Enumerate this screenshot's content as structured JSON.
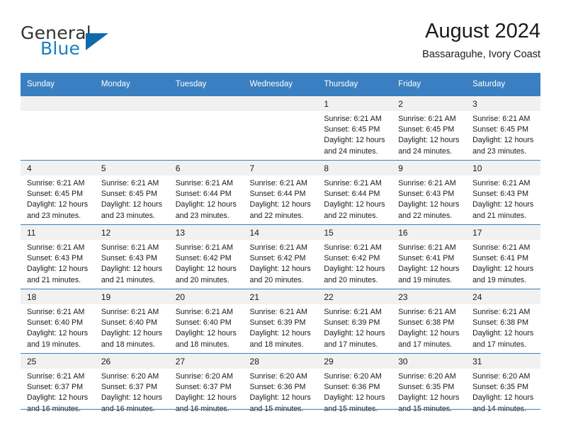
{
  "brand": {
    "name_top": "General",
    "name_bottom": "Blue",
    "triangle_icon": "blue-triangle-logo",
    "accent_color": "#1b7ec2"
  },
  "header": {
    "title": "August 2024",
    "subtitle": "Bassaraguhe, Ivory Coast"
  },
  "theme": {
    "header_blue": "#3a7fc1",
    "daynum_band": "#f1f1f1",
    "text": "#1a1a1a"
  },
  "weekday_headers": [
    "Sunday",
    "Monday",
    "Tuesday",
    "Wednesday",
    "Thursday",
    "Friday",
    "Saturday"
  ],
  "weeks": [
    [
      {
        "day": "",
        "sunrise": "",
        "sunset": "",
        "daylight_line1": "",
        "daylight_line2": ""
      },
      {
        "day": "",
        "sunrise": "",
        "sunset": "",
        "daylight_line1": "",
        "daylight_line2": ""
      },
      {
        "day": "",
        "sunrise": "",
        "sunset": "",
        "daylight_line1": "",
        "daylight_line2": ""
      },
      {
        "day": "",
        "sunrise": "",
        "sunset": "",
        "daylight_line1": "",
        "daylight_line2": ""
      },
      {
        "day": "1",
        "sunrise": "Sunrise: 6:21 AM",
        "sunset": "Sunset: 6:45 PM",
        "daylight_line1": "Daylight: 12 hours",
        "daylight_line2": "and 24 minutes."
      },
      {
        "day": "2",
        "sunrise": "Sunrise: 6:21 AM",
        "sunset": "Sunset: 6:45 PM",
        "daylight_line1": "Daylight: 12 hours",
        "daylight_line2": "and 24 minutes."
      },
      {
        "day": "3",
        "sunrise": "Sunrise: 6:21 AM",
        "sunset": "Sunset: 6:45 PM",
        "daylight_line1": "Daylight: 12 hours",
        "daylight_line2": "and 23 minutes."
      }
    ],
    [
      {
        "day": "4",
        "sunrise": "Sunrise: 6:21 AM",
        "sunset": "Sunset: 6:45 PM",
        "daylight_line1": "Daylight: 12 hours",
        "daylight_line2": "and 23 minutes."
      },
      {
        "day": "5",
        "sunrise": "Sunrise: 6:21 AM",
        "sunset": "Sunset: 6:45 PM",
        "daylight_line1": "Daylight: 12 hours",
        "daylight_line2": "and 23 minutes."
      },
      {
        "day": "6",
        "sunrise": "Sunrise: 6:21 AM",
        "sunset": "Sunset: 6:44 PM",
        "daylight_line1": "Daylight: 12 hours",
        "daylight_line2": "and 23 minutes."
      },
      {
        "day": "7",
        "sunrise": "Sunrise: 6:21 AM",
        "sunset": "Sunset: 6:44 PM",
        "daylight_line1": "Daylight: 12 hours",
        "daylight_line2": "and 22 minutes."
      },
      {
        "day": "8",
        "sunrise": "Sunrise: 6:21 AM",
        "sunset": "Sunset: 6:44 PM",
        "daylight_line1": "Daylight: 12 hours",
        "daylight_line2": "and 22 minutes."
      },
      {
        "day": "9",
        "sunrise": "Sunrise: 6:21 AM",
        "sunset": "Sunset: 6:43 PM",
        "daylight_line1": "Daylight: 12 hours",
        "daylight_line2": "and 22 minutes."
      },
      {
        "day": "10",
        "sunrise": "Sunrise: 6:21 AM",
        "sunset": "Sunset: 6:43 PM",
        "daylight_line1": "Daylight: 12 hours",
        "daylight_line2": "and 21 minutes."
      }
    ],
    [
      {
        "day": "11",
        "sunrise": "Sunrise: 6:21 AM",
        "sunset": "Sunset: 6:43 PM",
        "daylight_line1": "Daylight: 12 hours",
        "daylight_line2": "and 21 minutes."
      },
      {
        "day": "12",
        "sunrise": "Sunrise: 6:21 AM",
        "sunset": "Sunset: 6:43 PM",
        "daylight_line1": "Daylight: 12 hours",
        "daylight_line2": "and 21 minutes."
      },
      {
        "day": "13",
        "sunrise": "Sunrise: 6:21 AM",
        "sunset": "Sunset: 6:42 PM",
        "daylight_line1": "Daylight: 12 hours",
        "daylight_line2": "and 20 minutes."
      },
      {
        "day": "14",
        "sunrise": "Sunrise: 6:21 AM",
        "sunset": "Sunset: 6:42 PM",
        "daylight_line1": "Daylight: 12 hours",
        "daylight_line2": "and 20 minutes."
      },
      {
        "day": "15",
        "sunrise": "Sunrise: 6:21 AM",
        "sunset": "Sunset: 6:42 PM",
        "daylight_line1": "Daylight: 12 hours",
        "daylight_line2": "and 20 minutes."
      },
      {
        "day": "16",
        "sunrise": "Sunrise: 6:21 AM",
        "sunset": "Sunset: 6:41 PM",
        "daylight_line1": "Daylight: 12 hours",
        "daylight_line2": "and 19 minutes."
      },
      {
        "day": "17",
        "sunrise": "Sunrise: 6:21 AM",
        "sunset": "Sunset: 6:41 PM",
        "daylight_line1": "Daylight: 12 hours",
        "daylight_line2": "and 19 minutes."
      }
    ],
    [
      {
        "day": "18",
        "sunrise": "Sunrise: 6:21 AM",
        "sunset": "Sunset: 6:40 PM",
        "daylight_line1": "Daylight: 12 hours",
        "daylight_line2": "and 19 minutes."
      },
      {
        "day": "19",
        "sunrise": "Sunrise: 6:21 AM",
        "sunset": "Sunset: 6:40 PM",
        "daylight_line1": "Daylight: 12 hours",
        "daylight_line2": "and 18 minutes."
      },
      {
        "day": "20",
        "sunrise": "Sunrise: 6:21 AM",
        "sunset": "Sunset: 6:40 PM",
        "daylight_line1": "Daylight: 12 hours",
        "daylight_line2": "and 18 minutes."
      },
      {
        "day": "21",
        "sunrise": "Sunrise: 6:21 AM",
        "sunset": "Sunset: 6:39 PM",
        "daylight_line1": "Daylight: 12 hours",
        "daylight_line2": "and 18 minutes."
      },
      {
        "day": "22",
        "sunrise": "Sunrise: 6:21 AM",
        "sunset": "Sunset: 6:39 PM",
        "daylight_line1": "Daylight: 12 hours",
        "daylight_line2": "and 17 minutes."
      },
      {
        "day": "23",
        "sunrise": "Sunrise: 6:21 AM",
        "sunset": "Sunset: 6:38 PM",
        "daylight_line1": "Daylight: 12 hours",
        "daylight_line2": "and 17 minutes."
      },
      {
        "day": "24",
        "sunrise": "Sunrise: 6:21 AM",
        "sunset": "Sunset: 6:38 PM",
        "daylight_line1": "Daylight: 12 hours",
        "daylight_line2": "and 17 minutes."
      }
    ],
    [
      {
        "day": "25",
        "sunrise": "Sunrise: 6:21 AM",
        "sunset": "Sunset: 6:37 PM",
        "daylight_line1": "Daylight: 12 hours",
        "daylight_line2": "and 16 minutes."
      },
      {
        "day": "26",
        "sunrise": "Sunrise: 6:20 AM",
        "sunset": "Sunset: 6:37 PM",
        "daylight_line1": "Daylight: 12 hours",
        "daylight_line2": "and 16 minutes."
      },
      {
        "day": "27",
        "sunrise": "Sunrise: 6:20 AM",
        "sunset": "Sunset: 6:37 PM",
        "daylight_line1": "Daylight: 12 hours",
        "daylight_line2": "and 16 minutes."
      },
      {
        "day": "28",
        "sunrise": "Sunrise: 6:20 AM",
        "sunset": "Sunset: 6:36 PM",
        "daylight_line1": "Daylight: 12 hours",
        "daylight_line2": "and 15 minutes."
      },
      {
        "day": "29",
        "sunrise": "Sunrise: 6:20 AM",
        "sunset": "Sunset: 6:36 PM",
        "daylight_line1": "Daylight: 12 hours",
        "daylight_line2": "and 15 minutes."
      },
      {
        "day": "30",
        "sunrise": "Sunrise: 6:20 AM",
        "sunset": "Sunset: 6:35 PM",
        "daylight_line1": "Daylight: 12 hours",
        "daylight_line2": "and 15 minutes."
      },
      {
        "day": "31",
        "sunrise": "Sunrise: 6:20 AM",
        "sunset": "Sunset: 6:35 PM",
        "daylight_line1": "Daylight: 12 hours",
        "daylight_line2": "and 14 minutes."
      }
    ]
  ]
}
